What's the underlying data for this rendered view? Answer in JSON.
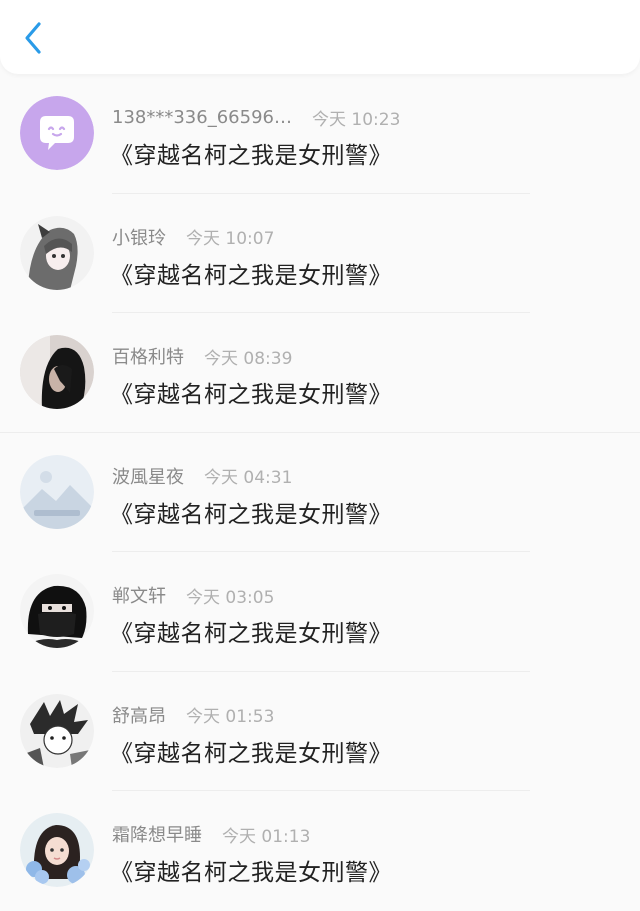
{
  "header": {
    "back_icon": "chevron-left-icon",
    "accent": "#2a9be8"
  },
  "messages": [
    {
      "name": "138***336_66596…",
      "time": "今天 10:23",
      "title": "《穿越名柯之我是女刑警》",
      "avatar": "chat-bubble-avatar"
    },
    {
      "name": "小银玲",
      "time": "今天 10:07",
      "title": "《穿越名柯之我是女刑警》",
      "avatar": "anime-girl-avatar"
    },
    {
      "name": "百格利特",
      "time": "今天 08:39",
      "title": "《穿越名柯之我是女刑警》",
      "avatar": "photo-avatar"
    },
    {
      "name": "波風星夜",
      "time": "今天 04:31",
      "title": "《穿越名柯之我是女刑警》",
      "avatar": "landscape-placeholder-avatar"
    },
    {
      "name": "郸文轩",
      "time": "今天 03:05",
      "title": "《穿越名柯之我是女刑警》",
      "avatar": "masked-person-avatar"
    },
    {
      "name": "舒高昂",
      "time": "今天 01:53",
      "title": "《穿越名柯之我是女刑警》",
      "avatar": "manga-avatar"
    },
    {
      "name": "霜降想早睡",
      "time": "今天 01:13",
      "title": "《穿越名柯之我是女刑警》",
      "avatar": "girl-photo-avatar"
    }
  ]
}
